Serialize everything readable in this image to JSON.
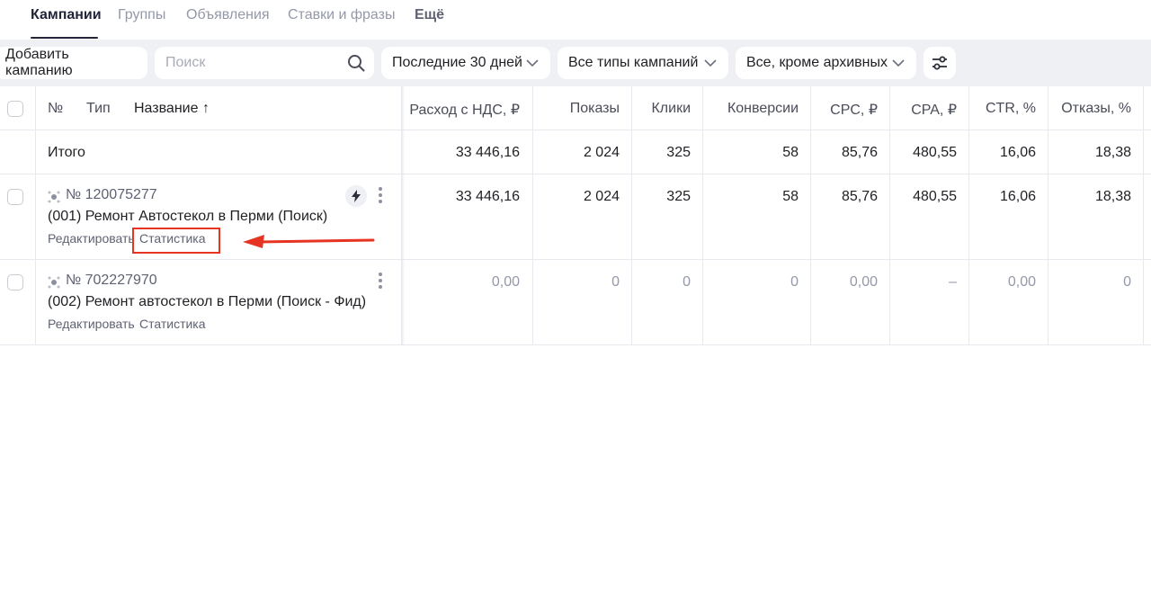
{
  "tabs": [
    {
      "label": "Кампании",
      "active": true
    },
    {
      "label": "Группы"
    },
    {
      "label": "Объявления"
    },
    {
      "label": "Ставки и фразы"
    },
    {
      "label": "Ещё"
    }
  ],
  "toolbar": {
    "add_campaign_label": "Добавить кампанию",
    "search_placeholder": "Поиск",
    "search_value": "",
    "period_label": "Последние 30 дней",
    "campaign_types_label": "Все типы кампаний",
    "archive_filter_label": "Все, кроме архивных",
    "settings_icon": "sliders-icon"
  },
  "table": {
    "headers": {
      "num": "№",
      "type": "Тип",
      "name": "Название ↑",
      "cost": "Расход с НДС, ₽",
      "impressions": "Показы",
      "clicks": "Клики",
      "conversions": "Конверсии",
      "cpc": "CPC, ₽",
      "cpa": "CPA, ₽",
      "ctr": "CTR, %",
      "bounces": "Отказы, %"
    },
    "total": {
      "label": "Итого",
      "cost": "33 446,16",
      "impressions": "2 024",
      "clicks": "325",
      "conversions": "58",
      "cpc": "85,76",
      "cpa": "480,55",
      "ctr": "16,06",
      "bounces": "18,38"
    },
    "rows": [
      {
        "id": "№ 120075277",
        "title": "(001) Ремонт Автостекол в Перми (Поиск)",
        "edit_link": "Редактировать",
        "stats_link": "Статистика",
        "cost": "33 446,16",
        "impressions": "2 024",
        "clicks": "325",
        "conversions": "58",
        "cpc": "85,76",
        "cpa": "480,55",
        "ctr": "16,06",
        "bounces": "18,38"
      },
      {
        "id": "№ 702227970",
        "title": "(002) Ремонт автостекол в Перми (Поиск - Фид)",
        "edit_link": "Редактировать",
        "stats_link": "Статистика",
        "cost": "0,00",
        "impressions": "0",
        "clicks": "0",
        "conversions": "0",
        "cpc": "0,00",
        "cpa": "–",
        "ctr": "0,00",
        "bounces": "0"
      }
    ]
  },
  "annotation": {
    "color": "#e63322"
  }
}
